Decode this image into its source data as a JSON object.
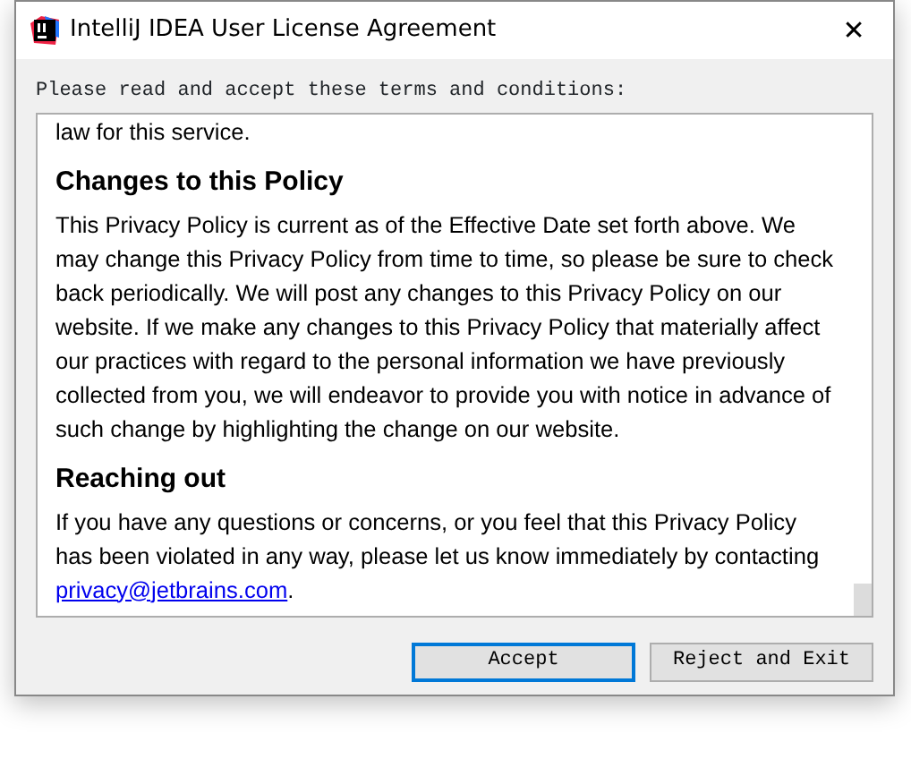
{
  "window": {
    "title": "IntelliJ IDEA User License Agreement",
    "close": "✕"
  },
  "prompt": "Please read and accept these terms and conditions:",
  "document": [
    {
      "kind": "paragraph",
      "text": "law for this service."
    },
    {
      "kind": "heading",
      "text": "Changes to this Policy"
    },
    {
      "kind": "paragraph",
      "text": "This Privacy Policy is current as of the Effective Date set forth above. We may change this Privacy Policy from time to time, so please be sure to check back periodically. We will post any changes to this Privacy Policy on our website. If we make any changes to this Privacy Policy that materially affect our practices with regard to the personal information we have previously collected from you, we will endeavor to provide you with notice in advance of such change by highlighting the change on our website."
    },
    {
      "kind": "heading",
      "text": "Reaching out"
    },
    {
      "kind": "paragraph",
      "text": "If you have any questions or concerns, or you feel that this Privacy Policy has been violated in any way, please let us know immediately by contacting",
      "link": "privacy@jetbrains.com",
      "tail": "."
    }
  ],
  "buttons": [
    {
      "label": "Accept",
      "focused": true
    },
    {
      "label": "Reject and Exit",
      "focused": false
    }
  ]
}
